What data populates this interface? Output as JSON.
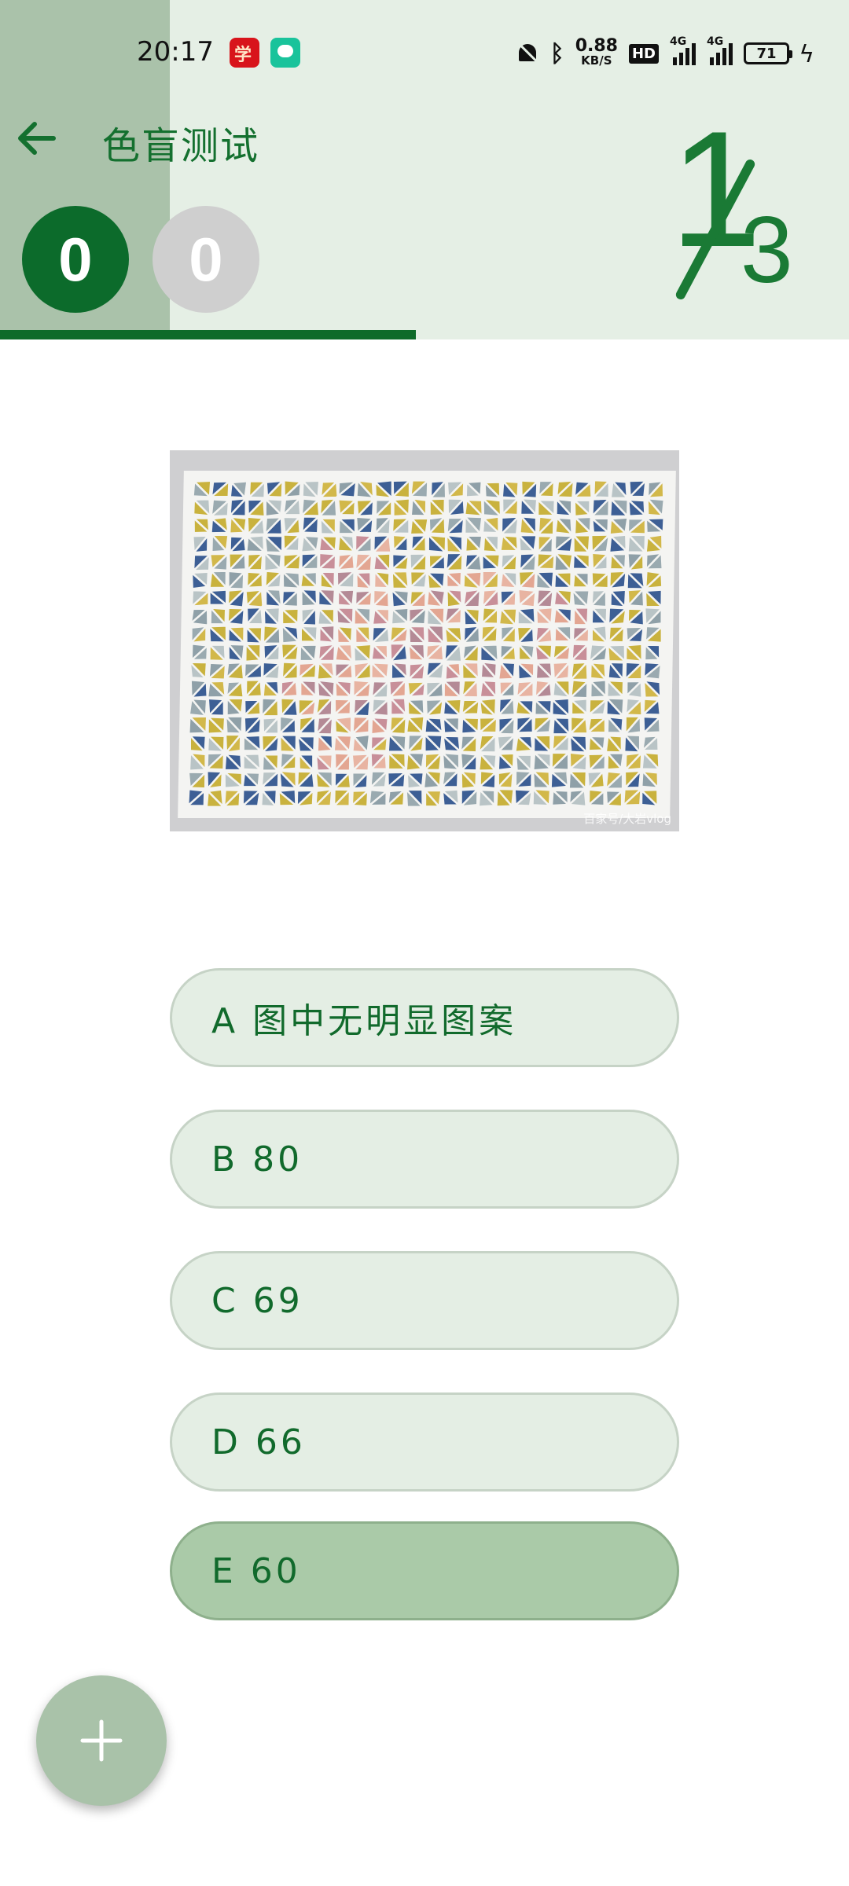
{
  "status_bar": {
    "time": "20:17",
    "net_speed_value": "0.88",
    "net_speed_unit": "KB/S",
    "hd_label": "HD",
    "signal_1_label": "4G",
    "signal_2_label": "4G",
    "battery_level": "71",
    "icons": [
      "xuexi-app-icon",
      "messages-app-icon",
      "mute-icon",
      "bluetooth-icon",
      "hd-icon",
      "signal-icon",
      "signal-icon",
      "battery-icon",
      "charging-icon"
    ]
  },
  "app_bar": {
    "title": "色盲测试",
    "back_icon": "arrow-left-icon"
  },
  "scores": {
    "correct": "0",
    "wrong": "0"
  },
  "progress": {
    "current": "1",
    "total": "3",
    "fraction": 0.49
  },
  "test_image": {
    "watermark": "百家号/大岩vlog"
  },
  "options": [
    {
      "label": "A 图中无明显图案",
      "selected": false
    },
    {
      "label": "B 80",
      "selected": false
    },
    {
      "label": "C 69",
      "selected": false
    },
    {
      "label": "D 66",
      "selected": false
    },
    {
      "label": "E 60",
      "selected": true
    }
  ],
  "fab": {
    "icon": "plus-icon"
  },
  "colors": {
    "primary": "#0c6b2b",
    "header_bg": "#e5efe5",
    "option_bg": "#e4eee4",
    "option_selected_bg": "#aacaa8",
    "score_wrong_bg": "#cfcfcf"
  }
}
